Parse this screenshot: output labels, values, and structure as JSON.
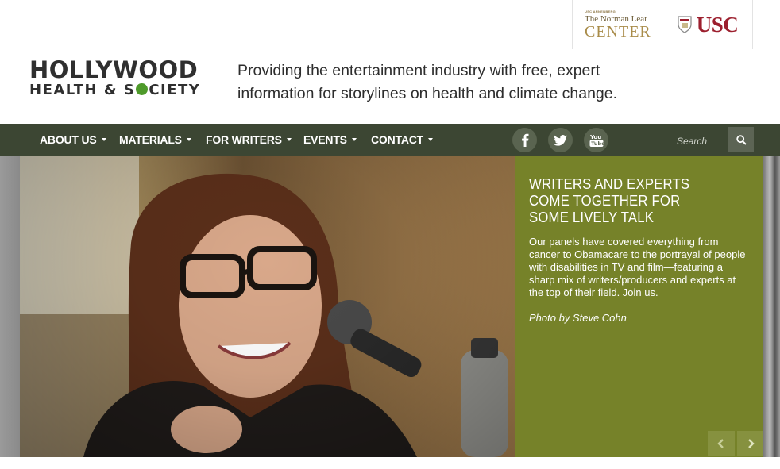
{
  "partners": {
    "lear_small": "USC ANNENBERG",
    "lear_name": "The Norman Lear",
    "lear_center": "CENTER",
    "usc": "USC"
  },
  "logo": {
    "line1": "HOLLYWOOD",
    "line2_a": "HEALTH & S",
    "line2_b": "CIETY"
  },
  "tagline": "Providing the entertainment industry with free, expert information for storylines on health and climate change.",
  "nav": {
    "items": [
      {
        "label": "ABOUT US"
      },
      {
        "label": "MATERIALS"
      },
      {
        "label": "FOR WRITERS"
      },
      {
        "label": "EVENTS"
      },
      {
        "label": "CONTACT"
      }
    ],
    "social": [
      "facebook-icon",
      "twitter-icon",
      "youtube-icon"
    ],
    "search_placeholder": "Search"
  },
  "hero": {
    "title": "WRITERS AND EXPERTS\nCOME TOGETHER FOR\nSOME LIVELY TALK",
    "body": "Our panels have covered everything from cancer to Obamacare to the portrayal of people with disabilities in TV and film—featuring a sharp mix of writers/producers and experts at the top of their field. Join us.",
    "credit": "Photo by Steve Cohn"
  },
  "colors": {
    "nav_bg": "#3c4633",
    "caption_bg": "#768229",
    "usc_red": "#9c1f2e",
    "lear_gold": "#a98c4a"
  }
}
